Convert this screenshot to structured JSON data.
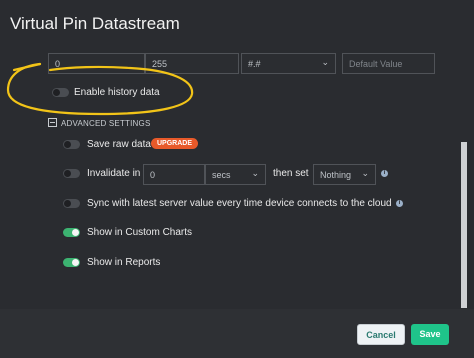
{
  "title": "Virtual Pin Datastream",
  "range": {
    "min": "0",
    "max": "255",
    "format": "#.#",
    "default_placeholder": "Default Value"
  },
  "history": {
    "label": "Enable history data",
    "enabled": false
  },
  "advanced": {
    "header": "ADVANCED SETTINGS",
    "save_raw": {
      "label": "Save raw data",
      "badge": "UPGRADE",
      "enabled": false
    },
    "invalidate": {
      "label": "Invalidate in",
      "value": "0",
      "unit": "secs",
      "then_label": "then set",
      "then_value": "Nothing",
      "enabled": false
    },
    "sync": {
      "label": "Sync with latest server value every time device connects to the cloud",
      "enabled": false
    },
    "custom_charts": {
      "label": "Show in Custom Charts",
      "enabled": true
    },
    "reports": {
      "label": "Show in Reports",
      "enabled": true
    }
  },
  "footer": {
    "cancel_label": "Cancel",
    "save_label": "Save"
  },
  "colors": {
    "accent": "#1fc48a",
    "annotation": "#f2c418",
    "badge": "#e85a2a"
  }
}
